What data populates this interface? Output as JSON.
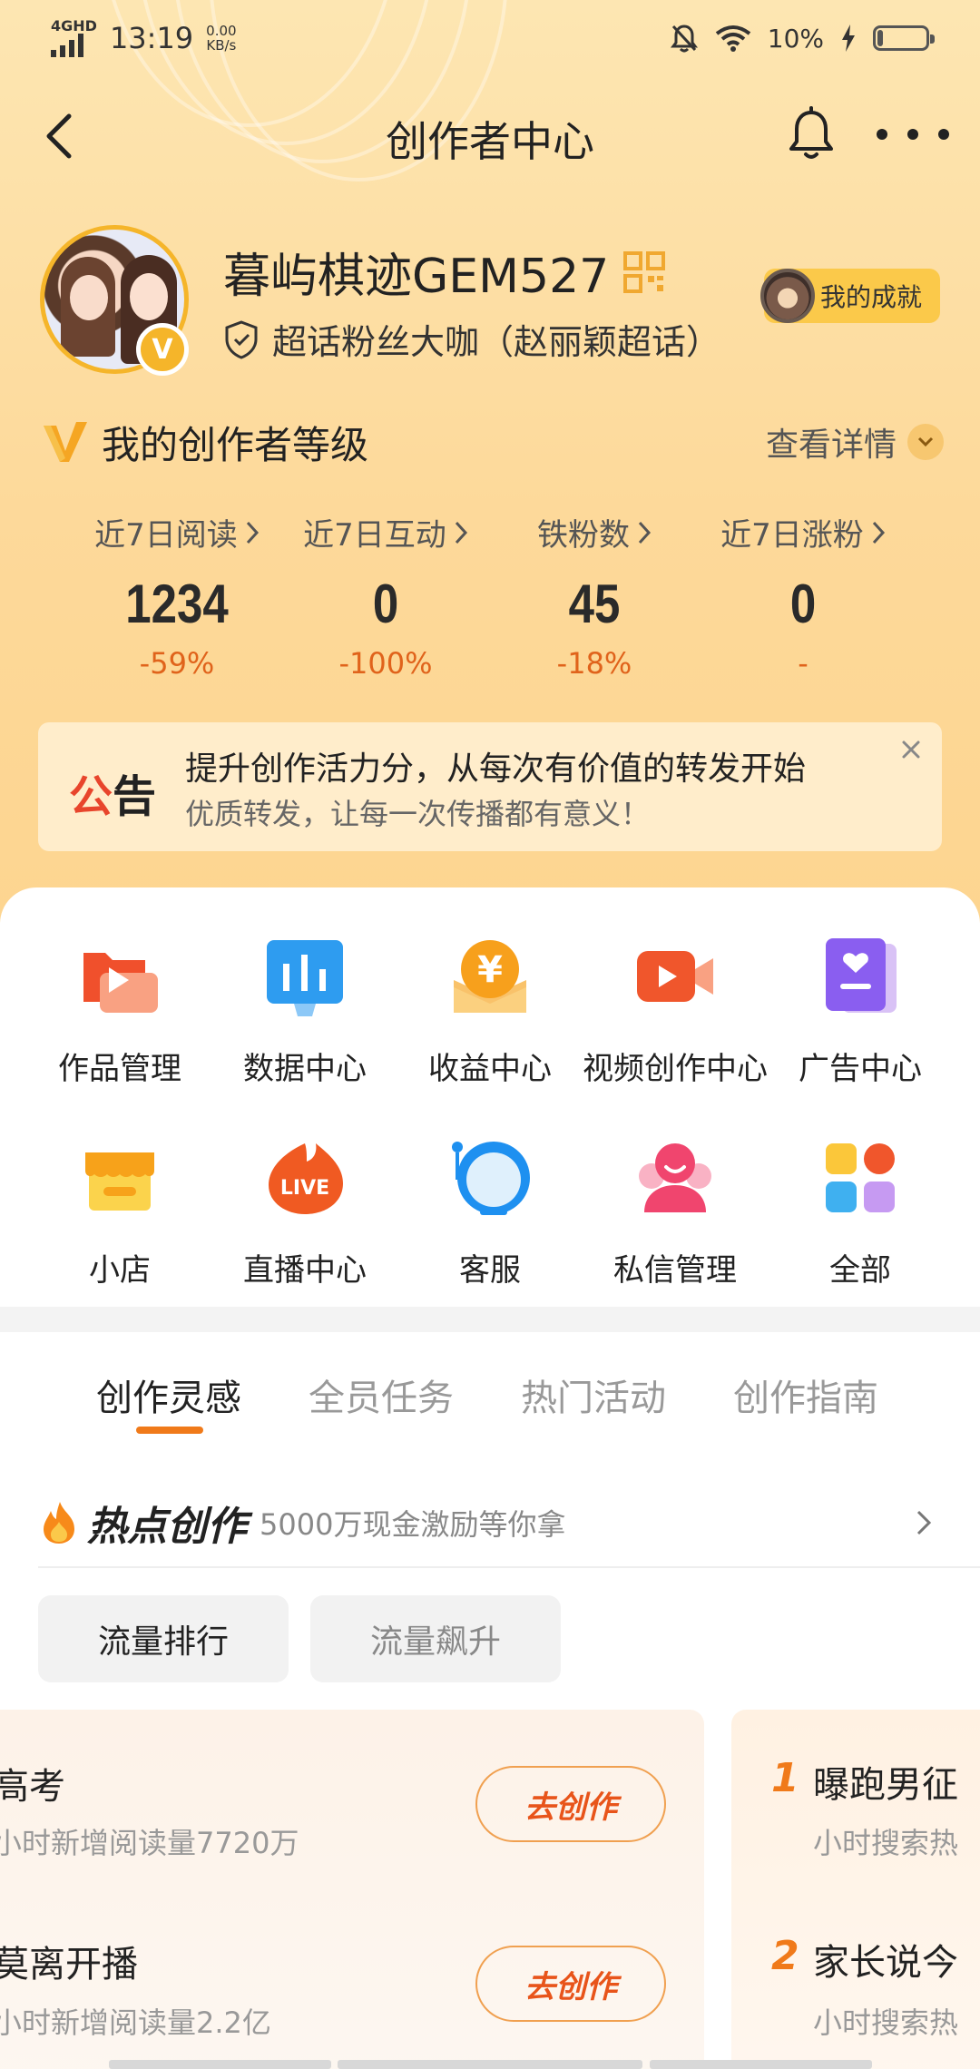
{
  "status_bar": {
    "network": "4GHD",
    "time": "13:19",
    "speed_value": "0.00",
    "speed_unit": "KB/s",
    "battery": "10%"
  },
  "nav": {
    "title": "创作者中心"
  },
  "profile": {
    "username": "暮屿棋迹GEM527",
    "fan_title": "超话粉丝大咖（赵丽颖超话）",
    "verified_badge": "V",
    "achievement_label": "我的成就"
  },
  "level": {
    "title": "我的创作者等级",
    "detail_label": "查看详情"
  },
  "stats": [
    {
      "label": "近7日阅读",
      "value": "1234",
      "change": "-59%"
    },
    {
      "label": "近7日互动",
      "value": "0",
      "change": "-100%"
    },
    {
      "label": "铁粉数",
      "value": "45",
      "change": "-18%"
    },
    {
      "label": "近7日涨粉",
      "value": "0",
      "change": "-"
    }
  ],
  "notice": {
    "tag_part1": "公",
    "tag_part2": "告",
    "line1": "提升创作活力分，从每次有价值的转发开始",
    "line2": "优质转发，让每一次传播都有意义！"
  },
  "grid": [
    {
      "label": "作品管理",
      "icon": "works-icon"
    },
    {
      "label": "数据中心",
      "icon": "data-icon"
    },
    {
      "label": "收益中心",
      "icon": "income-icon"
    },
    {
      "label": "视频创作中心",
      "icon": "video-icon"
    },
    {
      "label": "广告中心",
      "icon": "ad-icon"
    },
    {
      "label": "小店",
      "icon": "shop-icon"
    },
    {
      "label": "直播中心",
      "icon": "live-icon"
    },
    {
      "label": "客服",
      "icon": "customer-service-icon"
    },
    {
      "label": "私信管理",
      "icon": "messages-icon"
    },
    {
      "label": "全部",
      "icon": "all-apps-icon"
    }
  ],
  "live_icon_text": "LIVE",
  "income_icon_text": "¥",
  "tabs": [
    "创作灵感",
    "全员任务",
    "热门活动",
    "创作指南"
  ],
  "hot": {
    "title": "热点创作",
    "subtitle": "5000万现金激励等你拿"
  },
  "pills": [
    "流量排行",
    "流量飙升"
  ],
  "cards": {
    "left": [
      {
        "title": "高考",
        "sub": "小时新增阅读量7720万",
        "button": "去创作"
      },
      {
        "title": "莫离开播",
        "sub": "小时新增阅读量2.2亿",
        "button": "去创作"
      }
    ],
    "right": [
      {
        "rank": "1",
        "title": "曝跑男征",
        "sub": "小时搜索热"
      },
      {
        "rank": "2",
        "title": "家长说今",
        "sub": "小时搜索热"
      }
    ]
  },
  "colors": {
    "accent": "#f07a1a",
    "change_red": "#e0631b",
    "bg_gold": "#fdd99a",
    "badge_gold": "#f5b52a"
  }
}
